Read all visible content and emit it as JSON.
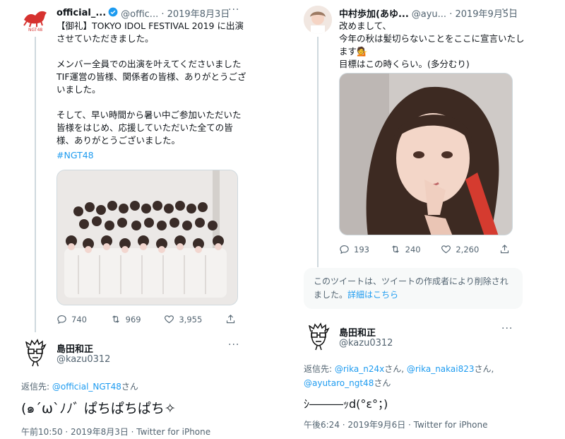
{
  "left": {
    "tweet1": {
      "name": "official_...",
      "handle_date": "@offic... · 2019年8月3日",
      "text": "【御礼】TOKYO IDOL FESTIVAL 2019 に出演\nさせていただきました。\n\nメンバー全員での出演を叶えてくださいました\nTIF運営の皆様、関係者の皆様、ありがとうござ\nいました。\n\nそして、早い時間から暑い中ご参加いただいた\n皆様をはじめ、応援していただいた全ての皆\n様、ありがとうございました。",
      "hashtag": "#NGT48",
      "replies": "740",
      "retweets": "969",
      "likes": "3,955"
    },
    "tweet2": {
      "name": "島田和正",
      "handle": "@kazu0312",
      "reply_prefix": "返信先: ",
      "reply_mention": "@official_NGT48",
      "reply_suffix": "さん",
      "text": "(๑´ω`ﾉﾉﾞ ぱちぱちぱち✧",
      "meta": "午前10:50 · 2019年8月3日 · Twitter for iPhone"
    }
  },
  "right": {
    "tweet1": {
      "name": "中村歩加(あゆ...",
      "handle_date": "@ayu... · 2019年9月5日",
      "text": "改めまして、\n今年の秋は髪切らないことをここに宣言いたし\nます💁\n目標はこの時くらい。(多分むり)",
      "replies": "193",
      "retweets": "240",
      "likes": "2,260"
    },
    "deleted": {
      "text": "このツイートは、ツイートの作成者により削除され\nました。",
      "link": "詳細はこちら"
    },
    "tweet2": {
      "name": "島田和正",
      "handle": "@kazu0312",
      "reply_prefix": "返信先: ",
      "mention1": "@rika_n24x",
      "sep1": "さん, ",
      "mention2": "@rika_nakai823",
      "sep2": "さん, ",
      "mention3": "@ayutaro_ngt48",
      "suffix": "さん",
      "text": "ｼ―――ｯd(°ε°；)",
      "meta": "午後6:24 · 2019年9月6日 · Twitter for iPhone"
    }
  },
  "colors": {
    "accent": "#1d9bf0",
    "muted": "#536471",
    "text": "#0f1419",
    "border": "#cfd9de"
  }
}
